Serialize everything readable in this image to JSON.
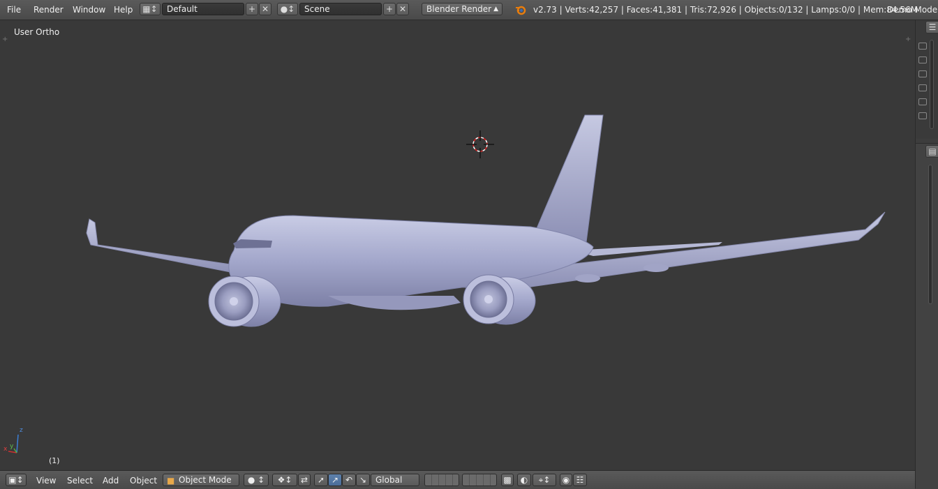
{
  "menu": {
    "items": [
      "File",
      "Render",
      "Window",
      "Help"
    ]
  },
  "layout_selector": {
    "value": "Default"
  },
  "scene_selector": {
    "value": "Scene"
  },
  "render_engine": {
    "value": "Blender Render"
  },
  "stats": {
    "text": "v2.73 | Verts:42,257 | Faces:41,381 | Tris:72,926 | Objects:0/132 | Lamps:0/0 | Mem:84.56M"
  },
  "mode_label": "Demo Mode:",
  "viewport": {
    "view_label": "User Ortho",
    "frame_label": "(1)",
    "axis_z": "z",
    "axis_x": "x",
    "axis_y": "y"
  },
  "bottom": {
    "view": "View",
    "select": "Select",
    "add": "Add",
    "object": "Object",
    "mode": "Object Mode",
    "orientation": "Global"
  },
  "colors": {
    "background": "#393939",
    "header": "#4a4a4a",
    "plane": "#a9adcf",
    "accent_blue": "#5e81ac"
  }
}
